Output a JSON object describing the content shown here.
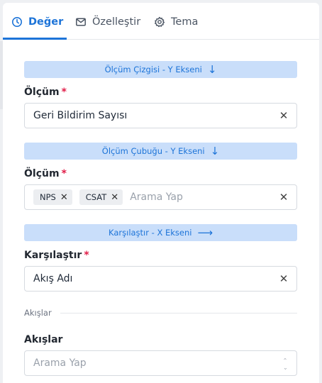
{
  "tabs": [
    {
      "label": "Değer",
      "icon": "gauge-icon",
      "active": true
    },
    {
      "label": "Özelleştir",
      "icon": "mail-icon",
      "active": false
    },
    {
      "label": "Tema",
      "icon": "gear-icon",
      "active": false
    }
  ],
  "sections": {
    "line_y": {
      "title": "Ölçüm Çizgisi - Y Ekseni",
      "arrow": "↓"
    },
    "bar_y": {
      "title": "Ölçüm Çubuğu - Y Ekseni",
      "arrow": "↓"
    },
    "compare_x": {
      "title": "Karşılaştır - X Ekseni",
      "arrow": "⟶"
    }
  },
  "fields": {
    "line_measure": {
      "label": "Ölçüm",
      "required": "*",
      "value": "Geri Bildirim Sayısı"
    },
    "bar_measure": {
      "label": "Ölçüm",
      "required": "*",
      "tags": [
        "NPS",
        "CSAT"
      ],
      "placeholder": "Arama Yap"
    },
    "compare": {
      "label": "Karşılaştır",
      "required": "*",
      "value": "Akış Adı"
    },
    "flows_divider": "Akışlar",
    "flows": {
      "label": "Akışlar",
      "placeholder": "Arama Yap"
    }
  },
  "colors": {
    "accent": "#1d74d8",
    "banner_bg": "#c9defa",
    "required": "#e11d48"
  }
}
